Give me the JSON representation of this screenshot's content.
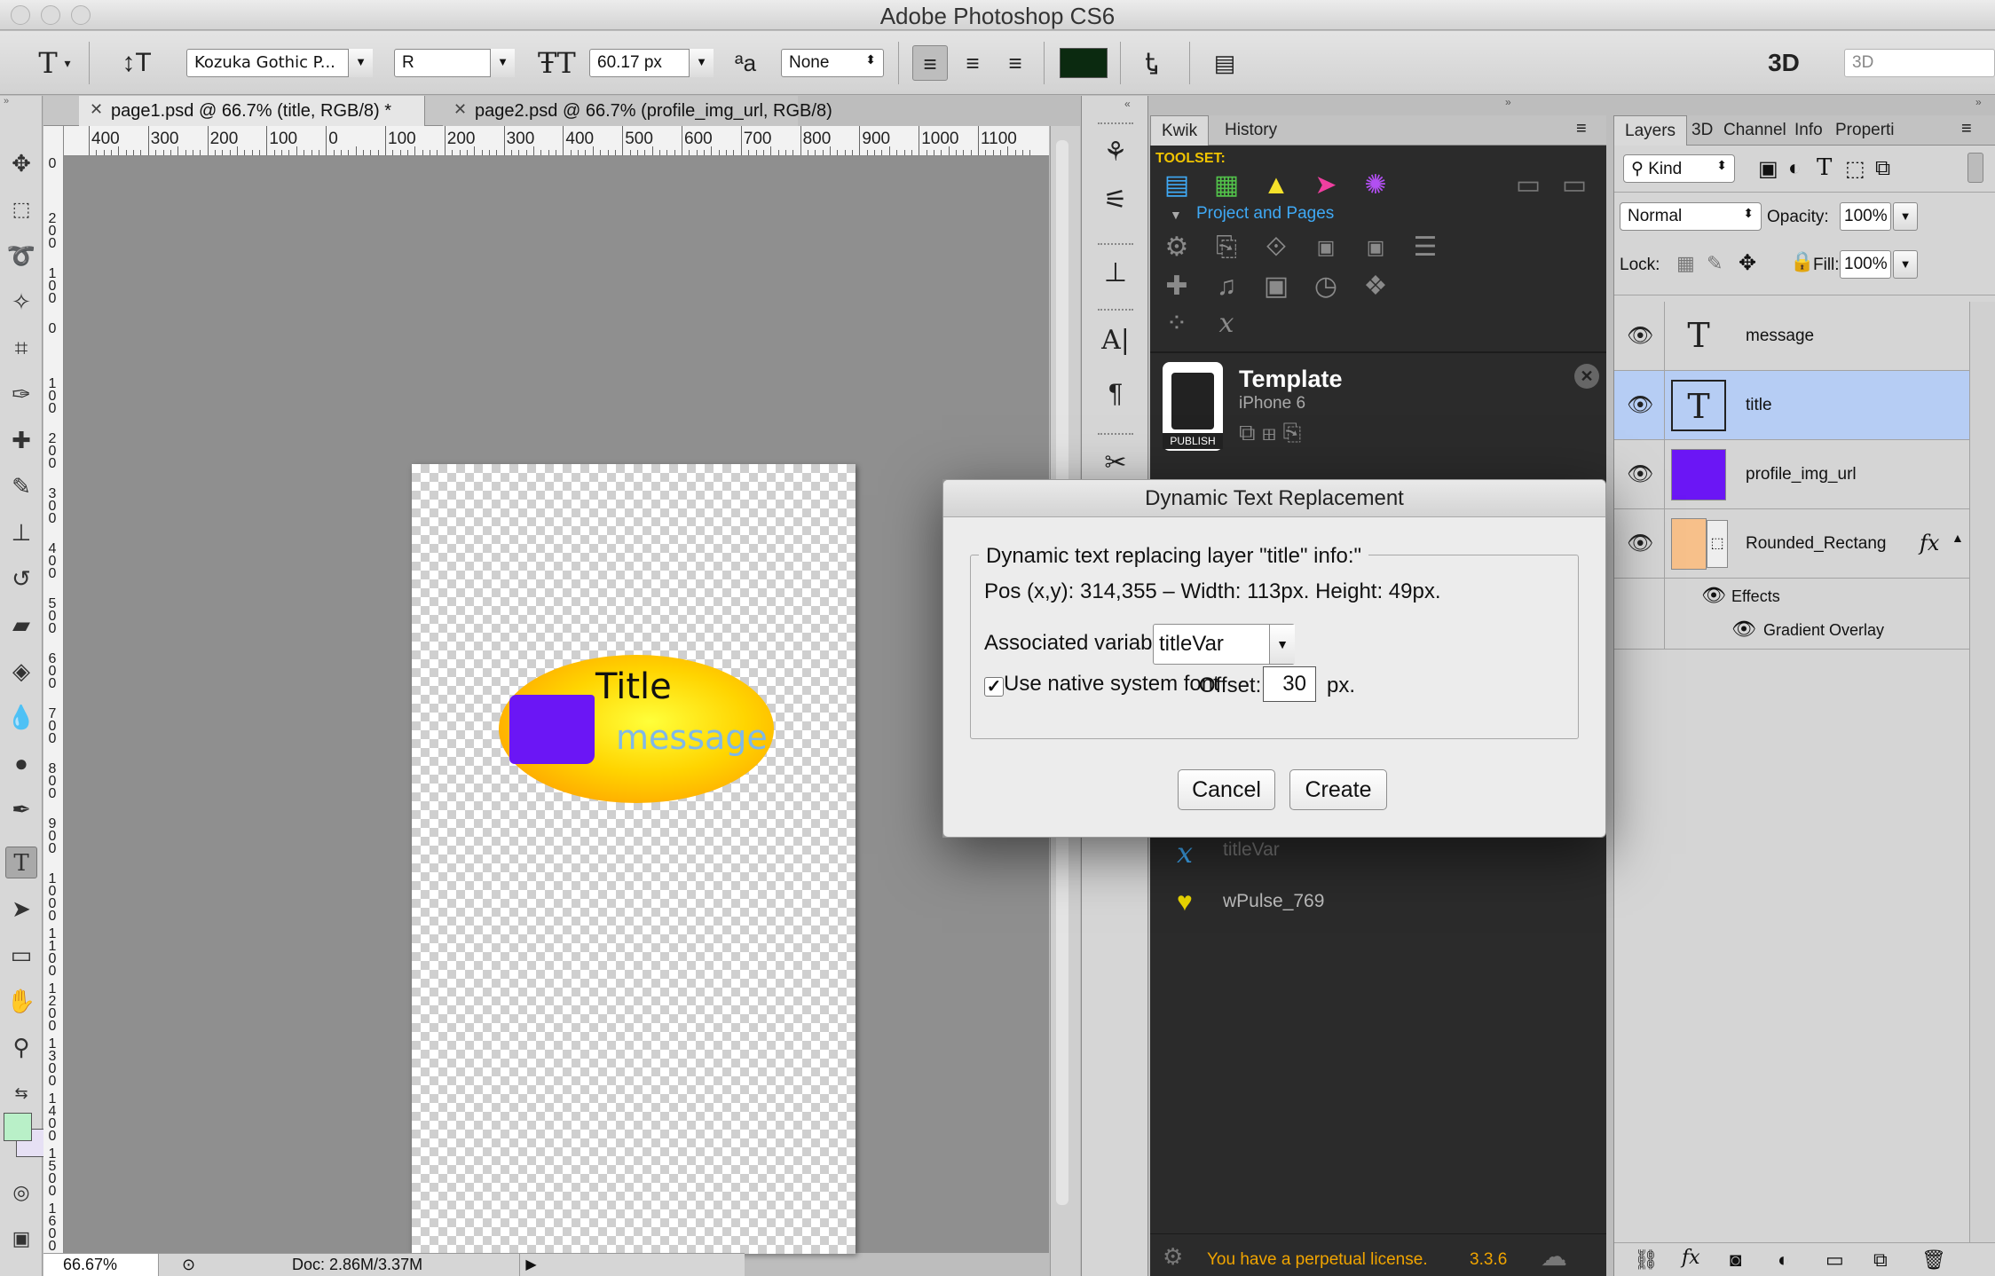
{
  "app": {
    "title": "Adobe Photoshop CS6"
  },
  "options_bar": {
    "font_family": "Kozuka Gothic P...",
    "font_style": "R",
    "font_size": "60.17 px",
    "anti_alias": "None",
    "mode_3d_label": "3D",
    "workspace_value": "3D"
  },
  "document_tabs": [
    {
      "label": "page1.psd @ 66.7% (title, RGB/8) *"
    },
    {
      "label": "page2.psd @ 66.7% (profile_img_url, RGB/8)"
    }
  ],
  "ruler": {
    "h_labels": [
      "400",
      "300",
      "200",
      "100",
      "0",
      "100",
      "200",
      "300",
      "400",
      "500",
      "600",
      "700",
      "800",
      "900",
      "1000",
      "1100"
    ],
    "v_labels": [
      "0",
      "2 0 0",
      "1 0 0",
      "0",
      "1 0 0",
      "2 0 0",
      "3 0 0",
      "4 0 0",
      "5 0 0",
      "6 0 0",
      "7 0 0",
      "8 0 0",
      "9 0 0",
      "1 0 0 0",
      "1 1 0 0",
      "1 2 0 0",
      "1 3 0 0",
      "1 4 0 0",
      "1 5 0 0",
      "1 6 0 0"
    ]
  },
  "canvas": {
    "title_text": "Title",
    "message_text": "message"
  },
  "status": {
    "zoom": "66.67%",
    "doc": "Doc: 2.86M/3.37M"
  },
  "kwik_panel": {
    "tabs": [
      "Kwik",
      "History"
    ],
    "toolset_label": "TOOLSET:",
    "section_label": "Project and Pages",
    "template_title": "Template",
    "template_device": "iPhone 6",
    "publish_label": "PUBLISH",
    "var_item": "titleVar",
    "pulse_item": "wPulse_769",
    "license_text": "You have a perpetual license.",
    "version": "3.3.6"
  },
  "layers_panel": {
    "tabs": [
      "Layers",
      "3D",
      "Channel",
      "Info",
      "Properti"
    ],
    "kind_label": "Kind",
    "blend_mode": "Normal",
    "opacity_label": "Opacity:",
    "opacity_value": "100%",
    "lock_label": "Lock:",
    "fill_label": "Fill:",
    "fill_value": "100%",
    "layers": [
      {
        "name": "message",
        "thumb": "T"
      },
      {
        "name": "title",
        "thumb": "T"
      },
      {
        "name": "profile_img_url",
        "thumb": ""
      },
      {
        "name": "Rounded_Rectang",
        "thumb": ""
      }
    ],
    "effects_label": "Effects",
    "gradient_overlay_label": "Gradient Overlay",
    "fx_label": "fx"
  },
  "dialog": {
    "title": "Dynamic Text Replacement",
    "group_title": "Dynamic text replacing layer \"title\" info:\"",
    "info_line": "Pos (x,y): 314,355 – Width: 113px. Height: 49px.",
    "variable_label": "Associated variable:",
    "variable_value": "titleVar",
    "native_font_label": "Use native system font",
    "native_font_checked": true,
    "offset_label": "Offset:",
    "offset_value": "30",
    "offset_unit": "px.",
    "cancel_label": "Cancel",
    "create_label": "Create"
  },
  "colors": {
    "foreground_swatch": "#b9f0c8",
    "background_swatch": "#e6e0f4",
    "text_color_swatch": "#0b2a10",
    "purple_layer": "#6b16f5",
    "selected_layer_bg": "#b6cdf4",
    "license_text_color": "#f0a400"
  }
}
